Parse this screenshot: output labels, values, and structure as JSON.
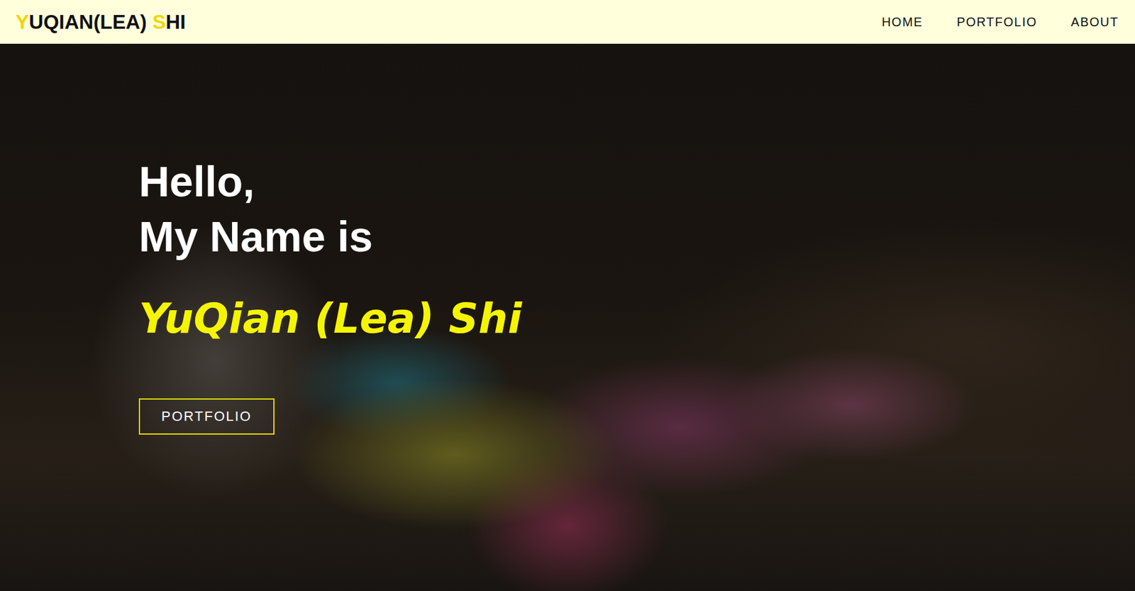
{
  "logo": [
    {
      "text": "Y",
      "accent": true
    },
    {
      "text": "UQIAN(LEA) ",
      "accent": false
    },
    {
      "text": "S",
      "accent": true
    },
    {
      "text": "HI",
      "accent": false
    }
  ],
  "nav": [
    {
      "label": "HOME"
    },
    {
      "label": "PORTFOLIO"
    },
    {
      "label": "ABOUT"
    }
  ],
  "hero": {
    "greeting": "Hello,",
    "intro": "My Name is",
    "name": "YuQian (Lea) Shi",
    "button": "PORTFOLIO"
  }
}
